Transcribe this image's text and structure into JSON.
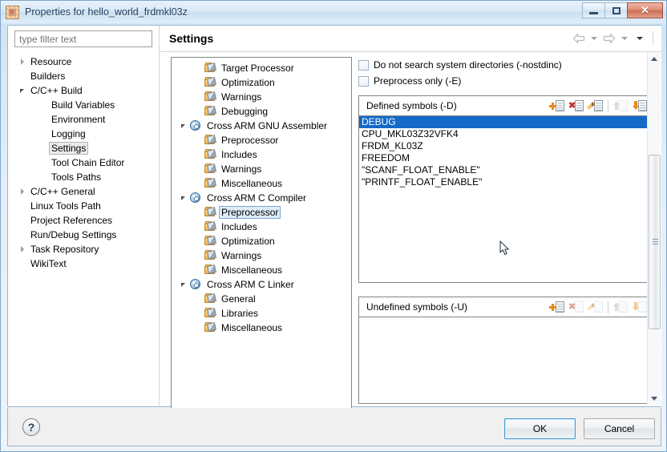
{
  "window": {
    "title": "Properties for hello_world_frdmkl03z",
    "icon": "project-icon",
    "controls": {
      "minimize": "Minimize",
      "maximize": "Maximize",
      "close": "Close",
      "close_glyph": "✕"
    }
  },
  "filter": {
    "placeholder": "type filter text",
    "value": ""
  },
  "nav_tree": {
    "items": [
      {
        "label": "Resource",
        "indent": 0,
        "state": "collapsed",
        "selected": false
      },
      {
        "label": "Builders",
        "indent": 0,
        "state": "leaf",
        "selected": false
      },
      {
        "label": "C/C++ Build",
        "indent": 0,
        "state": "expanded",
        "selected": false
      },
      {
        "label": "Build Variables",
        "indent": 1,
        "state": "leaf",
        "selected": false
      },
      {
        "label": "Environment",
        "indent": 1,
        "state": "leaf",
        "selected": false
      },
      {
        "label": "Logging",
        "indent": 1,
        "state": "leaf",
        "selected": false
      },
      {
        "label": "Settings",
        "indent": 1,
        "state": "leaf",
        "selected": true
      },
      {
        "label": "Tool Chain Editor",
        "indent": 1,
        "state": "leaf",
        "selected": false
      },
      {
        "label": "Tools Paths",
        "indent": 1,
        "state": "leaf",
        "selected": false
      },
      {
        "label": "C/C++ General",
        "indent": 0,
        "state": "collapsed",
        "selected": false
      },
      {
        "label": "Linux Tools Path",
        "indent": 0,
        "state": "leaf",
        "selected": false
      },
      {
        "label": "Project References",
        "indent": 0,
        "state": "leaf",
        "selected": false
      },
      {
        "label": "Run/Debug Settings",
        "indent": 0,
        "state": "leaf",
        "selected": false
      },
      {
        "label": "Task Repository",
        "indent": 0,
        "state": "collapsed",
        "selected": false
      },
      {
        "label": "WikiText",
        "indent": 0,
        "state": "leaf",
        "selected": false
      }
    ]
  },
  "page": {
    "title": "Settings",
    "nav": {
      "back": "back-arrow",
      "back_menu": "back-dropdown",
      "forward": "forward-arrow",
      "forward_menu": "forward-dropdown",
      "view_menu": "view-menu"
    }
  },
  "tool_tree": {
    "items": [
      {
        "label": "Target Processor",
        "indent": 1,
        "icon": "folder-tool-icon",
        "state": "leaf",
        "selected": false
      },
      {
        "label": "Optimization",
        "indent": 1,
        "icon": "folder-tool-icon",
        "state": "leaf",
        "selected": false
      },
      {
        "label": "Warnings",
        "indent": 1,
        "icon": "folder-tool-icon",
        "state": "leaf",
        "selected": false
      },
      {
        "label": "Debugging",
        "indent": 1,
        "icon": "folder-tool-icon",
        "state": "leaf",
        "selected": false
      },
      {
        "label": "Cross ARM GNU Assembler",
        "indent": 0,
        "icon": "gear-icon",
        "state": "expanded",
        "selected": false
      },
      {
        "label": "Preprocessor",
        "indent": 1,
        "icon": "folder-tool-icon",
        "state": "leaf",
        "selected": false
      },
      {
        "label": "Includes",
        "indent": 1,
        "icon": "folder-tool-icon",
        "state": "leaf",
        "selected": false
      },
      {
        "label": "Warnings",
        "indent": 1,
        "icon": "folder-tool-icon",
        "state": "leaf",
        "selected": false
      },
      {
        "label": "Miscellaneous",
        "indent": 1,
        "icon": "folder-tool-icon",
        "state": "leaf",
        "selected": false
      },
      {
        "label": "Cross ARM C Compiler",
        "indent": 0,
        "icon": "gear-icon",
        "state": "expanded",
        "selected": false
      },
      {
        "label": "Preprocessor",
        "indent": 1,
        "icon": "folder-tool-icon",
        "state": "leaf",
        "selected": true
      },
      {
        "label": "Includes",
        "indent": 1,
        "icon": "folder-tool-icon",
        "state": "leaf",
        "selected": false
      },
      {
        "label": "Optimization",
        "indent": 1,
        "icon": "folder-tool-icon",
        "state": "leaf",
        "selected": false
      },
      {
        "label": "Warnings",
        "indent": 1,
        "icon": "folder-tool-icon",
        "state": "leaf",
        "selected": false
      },
      {
        "label": "Miscellaneous",
        "indent": 1,
        "icon": "folder-tool-icon",
        "state": "leaf",
        "selected": false
      },
      {
        "label": "Cross ARM C Linker",
        "indent": 0,
        "icon": "gear-icon",
        "state": "expanded",
        "selected": false
      },
      {
        "label": "General",
        "indent": 1,
        "icon": "folder-tool-icon",
        "state": "leaf",
        "selected": false
      },
      {
        "label": "Libraries",
        "indent": 1,
        "icon": "folder-tool-icon",
        "state": "leaf",
        "selected": false
      },
      {
        "label": "Miscellaneous",
        "indent": 1,
        "icon": "folder-tool-icon",
        "state": "leaf",
        "selected": false
      }
    ]
  },
  "settings": {
    "checkboxes": [
      {
        "label": "Do not search system directories (-nostdinc)",
        "checked": false
      },
      {
        "label": "Preprocess only (-E)",
        "checked": false
      }
    ],
    "defined_symbols": {
      "title": "Defined symbols (-D)",
      "tools": [
        {
          "name": "add-symbol-button",
          "icon": "add-icon",
          "enabled": true
        },
        {
          "name": "delete-symbol-button",
          "icon": "delete-icon",
          "enabled": true
        },
        {
          "name": "edit-symbol-button",
          "icon": "edit-icon",
          "enabled": true
        },
        {
          "name": "move-up-button",
          "icon": "move-up-icon",
          "enabled": false
        },
        {
          "name": "move-down-button",
          "icon": "move-down-icon",
          "enabled": true
        }
      ],
      "items": [
        {
          "value": "DEBUG",
          "selected": true
        },
        {
          "value": "CPU_MKL03Z32VFK4",
          "selected": false
        },
        {
          "value": "FRDM_KL03Z",
          "selected": false
        },
        {
          "value": "FREEDOM",
          "selected": false
        },
        {
          "value": "\"SCANF_FLOAT_ENABLE\"",
          "selected": false
        },
        {
          "value": "\"PRINTF_FLOAT_ENABLE\"",
          "selected": false
        }
      ]
    },
    "undefined_symbols": {
      "title": "Undefined symbols (-U)",
      "tools": [
        {
          "name": "add-undef-symbol-button",
          "icon": "add-icon",
          "enabled": true
        },
        {
          "name": "delete-undef-symbol-button",
          "icon": "delete-icon",
          "enabled": false
        },
        {
          "name": "edit-undef-symbol-button",
          "icon": "edit-icon",
          "enabled": false
        },
        {
          "name": "undef-move-up-button",
          "icon": "move-up-icon",
          "enabled": false
        },
        {
          "name": "undef-move-down-button",
          "icon": "move-down-icon",
          "enabled": false
        }
      ],
      "items": []
    }
  },
  "footer": {
    "help": "?",
    "ok": "OK",
    "cancel": "Cancel"
  },
  "colors": {
    "selection": "#1569c7",
    "accent": "#3c9cd6",
    "titlebar": "#cfe3f4"
  }
}
